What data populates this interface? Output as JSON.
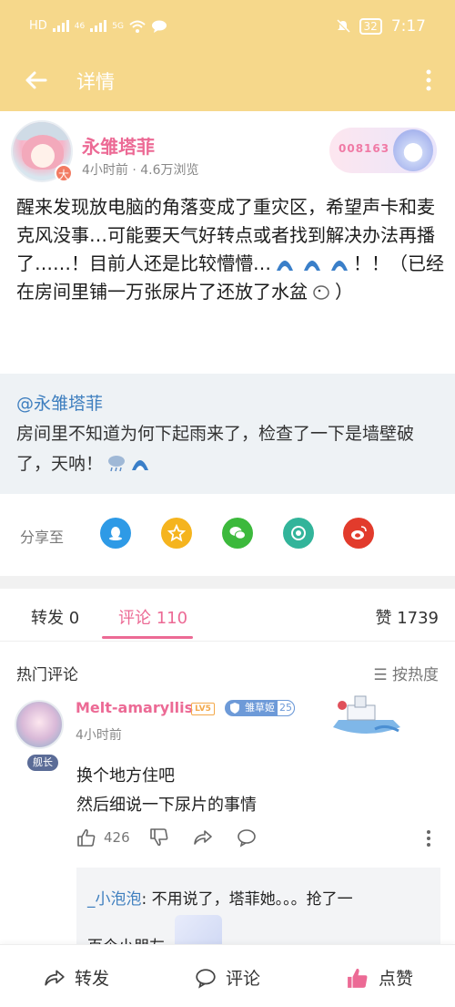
{
  "status_bar": {
    "left_text": [
      "HD",
      "46",
      "5G"
    ],
    "battery": "32",
    "time": "7:17"
  },
  "header": {
    "title": "详情"
  },
  "post": {
    "author": "永雏塔菲",
    "avatar_badge": "大",
    "meta": "4小时前 · 4.6万浏览",
    "fan_card_number": "008163",
    "text_parts": [
      "醒来发现放电脑的角落变成了重灾区，希望声卡和麦克风没事…可能要天气好转点或者找到解决办法再播了……！目前人还是比较懵懵…",
      "！！（已经在房间里铺一万张尿片了还放了水盆",
      "）"
    ],
    "quote": {
      "mention": "@永雏塔菲",
      "text": "房间里不知道为何下起雨来了，检查了一下是墙壁破了，天呐！"
    }
  },
  "share": {
    "label": "分享至",
    "targets": [
      {
        "name": "qq-icon",
        "color": "#2e9ae6"
      },
      {
        "name": "qzone-icon",
        "color": "#f5b41e"
      },
      {
        "name": "wechat-icon",
        "color": "#3cb93c"
      },
      {
        "name": "moments-icon",
        "color": "#32b49a"
      },
      {
        "name": "weibo-icon",
        "color": "#e23b2c"
      }
    ]
  },
  "tabs": {
    "repost": "转发 0",
    "comments": "评论 110",
    "likes": "赞 1739"
  },
  "comments_section": {
    "title": "热门评论",
    "sort_label": "☰ 按热度"
  },
  "comment": {
    "role_badge": "舰长",
    "name": "Melt-amaryllis",
    "level": "LV5",
    "medal_name": "雏草姬",
    "medal_level": "25",
    "time": "4小时前",
    "lines": [
      "换个地方住吧",
      "然后细说一下尿片的事情"
    ],
    "like_count": "426",
    "reply": {
      "user": "_小泡泡",
      "text": ": 不用说了，塔菲她。。。抢了一",
      "text2": "百个小朋友"
    }
  },
  "bottom_bar": {
    "repost": "转发",
    "comment": "评论",
    "like": "点赞"
  },
  "colors": {
    "header": "#f6d88b",
    "accent_pink": "#ec6a95",
    "link_blue": "#3f7fbf"
  }
}
